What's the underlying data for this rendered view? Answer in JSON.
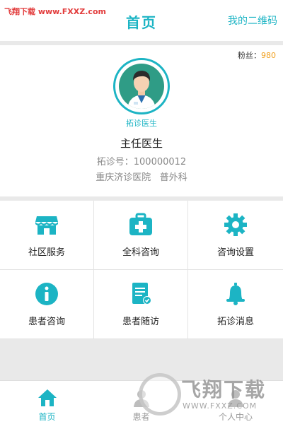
{
  "watermark_top": "飞翔下载 www.FXXZ.com",
  "header": {
    "title": "首页",
    "qr_link": "我的二维码"
  },
  "profile": {
    "fans_label": "粉丝：",
    "fans_count": "980",
    "badge": "拓诊医生",
    "role": "主任医生",
    "id_line": "拓诊号：100000012",
    "hospital": "重庆济诊医院",
    "department": "普外科"
  },
  "grid": [
    {
      "label": "社区服务",
      "icon": "shop-icon"
    },
    {
      "label": "全科咨询",
      "icon": "medical-kit-icon"
    },
    {
      "label": "咨询设置",
      "icon": "gear-icon"
    },
    {
      "label": "患者咨询",
      "icon": "info-icon"
    },
    {
      "label": "患者随访",
      "icon": "document-check-icon"
    },
    {
      "label": "拓诊消息",
      "icon": "bell-icon"
    }
  ],
  "tabs": [
    {
      "label": "首页",
      "icon": "home-icon",
      "active": true
    },
    {
      "label": "患者",
      "icon": "patients-icon",
      "active": false
    },
    {
      "label": "个人中心",
      "icon": "person-icon",
      "active": false
    }
  ],
  "watermark_bottom": {
    "text": "飞翔下载",
    "url": "WWW.FXXZ.COM"
  },
  "colors": {
    "accent": "#1cb4c4",
    "fans_number": "#f0a020",
    "background": "#e9e9e9"
  }
}
